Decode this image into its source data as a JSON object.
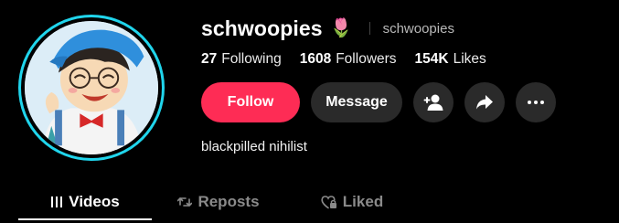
{
  "profile": {
    "display_name": "schwoopies",
    "name_emoji": "🌷",
    "handle": "schwoopies",
    "bio": "blackpilled nihilist"
  },
  "stats": [
    {
      "value": "27",
      "label": "Following"
    },
    {
      "value": "1608",
      "label": "Followers"
    },
    {
      "value": "154K",
      "label": "Likes"
    }
  ],
  "actions": {
    "follow_label": "Follow",
    "message_label": "Message",
    "icons": [
      "add-friend-icon",
      "share-icon",
      "more-icon"
    ]
  },
  "tabs": [
    {
      "label": "Videos",
      "icon": "grid-icon",
      "active": true
    },
    {
      "label": "Reposts",
      "icon": "repost-icon",
      "active": false
    },
    {
      "label": "Liked",
      "icon": "heart-lock-icon",
      "active": false
    }
  ],
  "colors": {
    "accent": "#fe2c55",
    "avatar_ring": "#20d5ec",
    "background": "#000000",
    "button_bg": "#2a2a2a"
  }
}
